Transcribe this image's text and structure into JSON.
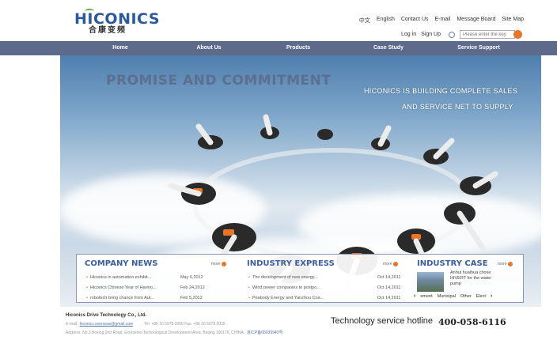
{
  "logo": {
    "en": "HICONICS",
    "cn": "合康变频"
  },
  "toplinks": [
    "中文",
    "English",
    "Contact Us",
    "E-mail",
    "Message Board",
    "Site Map"
  ],
  "account": {
    "login": "Log in",
    "signup": "Sign Up"
  },
  "search": {
    "placeholder": "Please enter the key"
  },
  "nav": [
    "Home",
    "About Us",
    "Products",
    "Case Study",
    "Service Support"
  ],
  "banner": {
    "title": "PROMISE AND COMMITMENT",
    "line1": "HICONICS IS BUILDING COMPLETE SALES",
    "line2": "AND SERVICE NET TO SUPPLY"
  },
  "company_news": {
    "title": "COMPANY NEWS",
    "more": "more",
    "items": [
      {
        "title": "Hiconics in automation exhibit...",
        "date": "May 6,2012"
      },
      {
        "title": "Hiconics Chinese Year of Harmo...",
        "date": "Feb 24,2012"
      },
      {
        "title": "robotech bring chance from Aut...",
        "date": "Feb 5,2012"
      }
    ]
  },
  "industry_express": {
    "title": "INDUSTRY EXPRESS",
    "more": "more",
    "items": [
      {
        "title": "The development of new energy...",
        "date": "Oct 14,2011"
      },
      {
        "title": "Wind power companies to postpo...",
        "date": "Oct 14,2011"
      },
      {
        "title": "Peabody Energy and Yanzhou Coa...",
        "date": "Oct 14,2011"
      }
    ]
  },
  "industry_case": {
    "title": "INDUSTRY CASE",
    "more": "more",
    "text": "Anhui huaihua chose HIVERT for the water pump",
    "tabs": [
      "ement",
      "Municipal",
      "Other",
      "Elect"
    ]
  },
  "footer": {
    "company": "Hiconics Drive Technology Co., Ltd.",
    "email_label": "E-mail:",
    "email": "hiconics.overseas@gmail.com",
    "tel": "Tel: +86 10 5978 0000   Fax: +86 10 5978 0035",
    "address": "Address: No.3 Boxing 2nd Road, Economic-Technological Development Area, Beijing 100176, CHINA",
    "icp": "京ICP备05039940号",
    "hotline_label": "Technology service hotline",
    "hotline_number": "400-058-6116"
  },
  "colors": {
    "nav": "#5e6a8c",
    "accent": "#e7762a",
    "brand": "#2a5a9c"
  }
}
